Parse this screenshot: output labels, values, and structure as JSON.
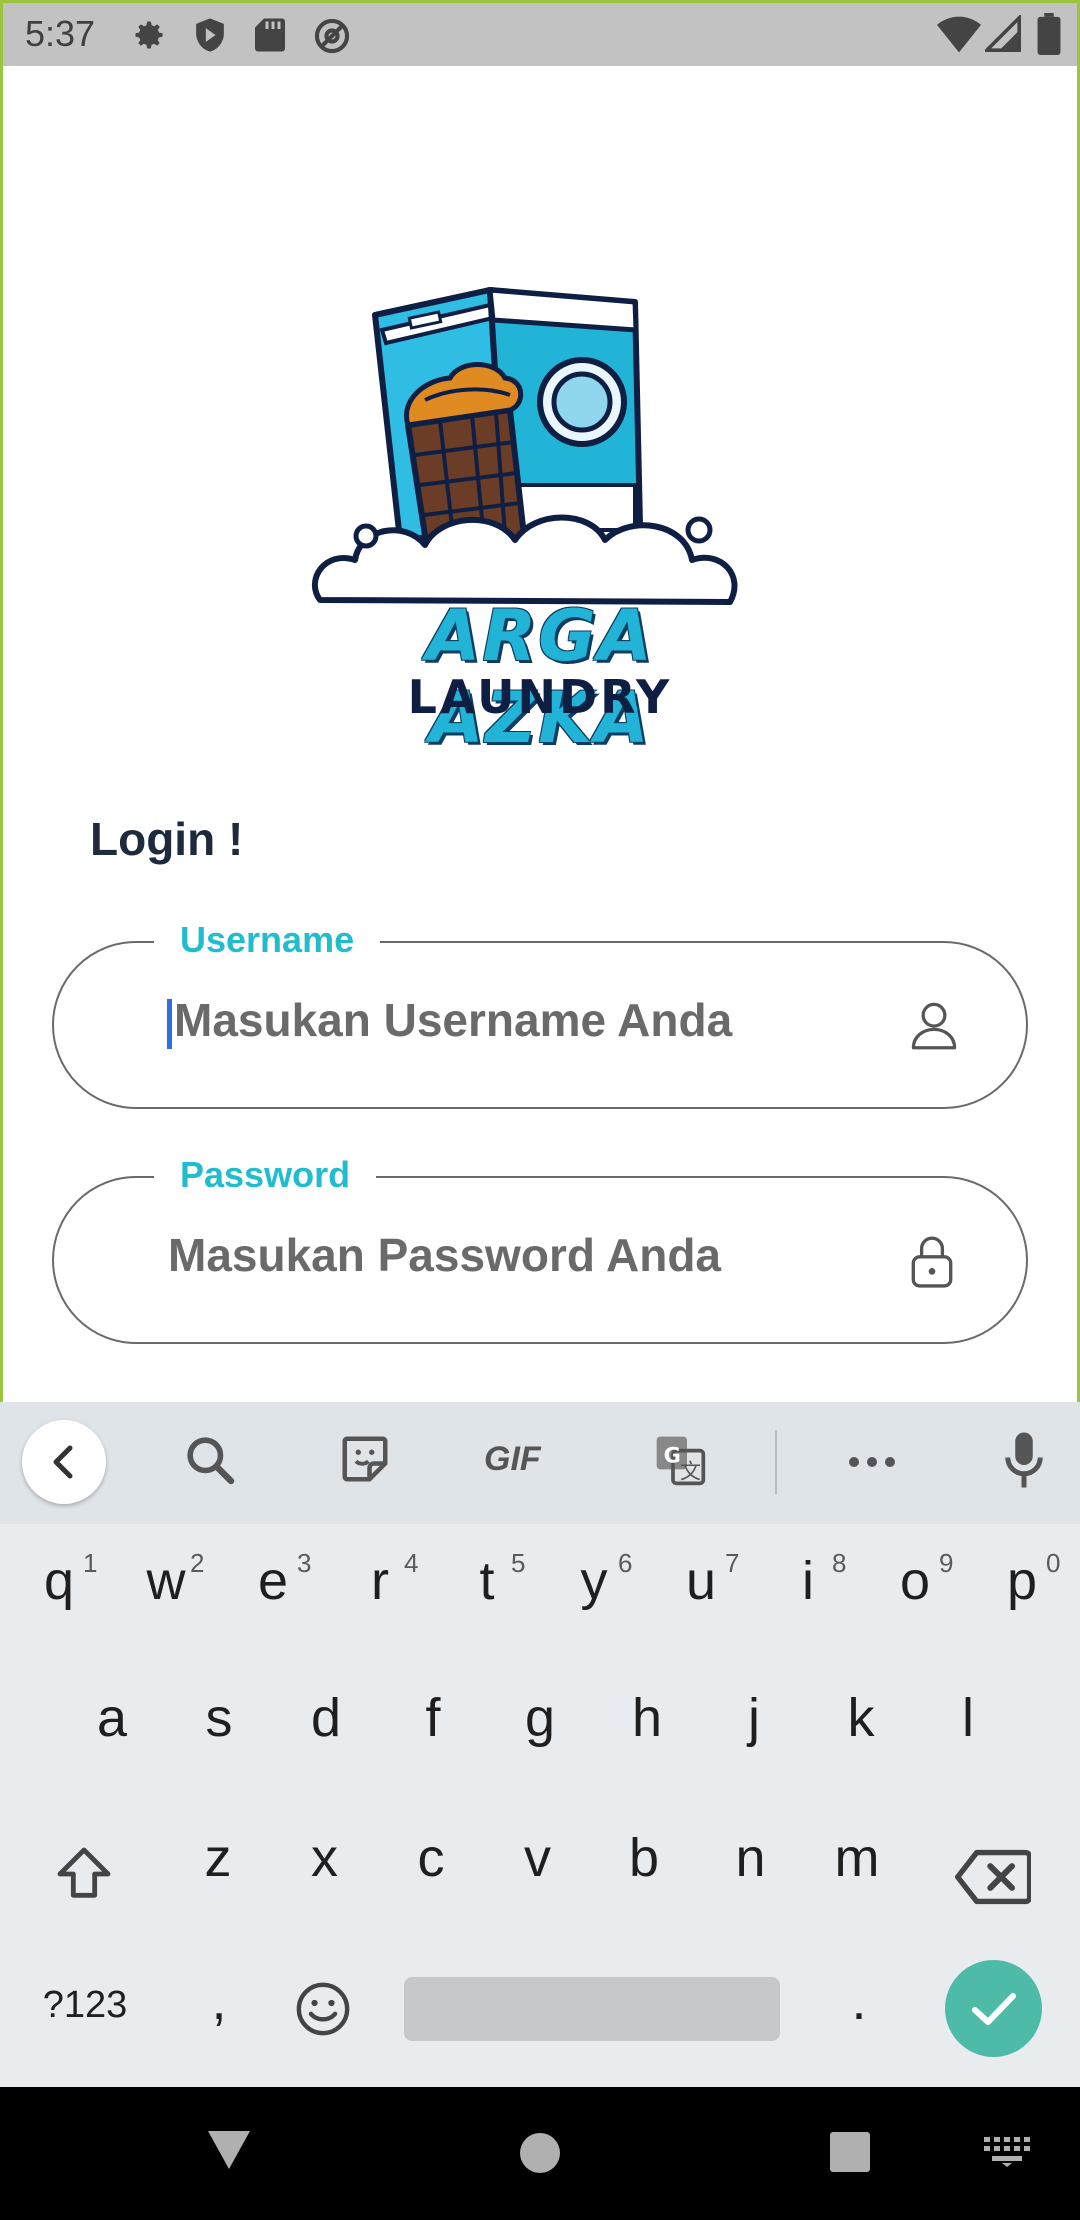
{
  "status_bar": {
    "time": "5:37",
    "left_icons": [
      "gear-icon",
      "play-protect-icon",
      "sd-card-icon",
      "at-sign-icon"
    ],
    "right_icons": [
      "wifi-icon",
      "signal-icon",
      "battery-icon"
    ]
  },
  "logo": {
    "line1": "ARGA AZKA",
    "line2": "LAUNDRY",
    "colors": {
      "primary": "#21b4d6",
      "dark": "#0f1f44"
    }
  },
  "login": {
    "title": "Login !",
    "username": {
      "label": "Username",
      "placeholder": "Masukan Username Anda",
      "icon": "user-icon"
    },
    "password": {
      "label": "Password",
      "placeholder": "Masukan Password Anda",
      "icon": "lock-icon"
    }
  },
  "keyboard": {
    "toolbar": [
      "back",
      "search-icon",
      "sticker-icon",
      "GIF",
      "translate-icon",
      "more-icon",
      "mic-icon"
    ],
    "gif_label": "GIF",
    "row1": [
      "q",
      "w",
      "e",
      "r",
      "t",
      "y",
      "u",
      "i",
      "o",
      "p"
    ],
    "row1_hints": [
      "1",
      "2",
      "3",
      "4",
      "5",
      "6",
      "7",
      "8",
      "9",
      "0"
    ],
    "row2": [
      "a",
      "s",
      "d",
      "f",
      "g",
      "h",
      "j",
      "k",
      "l"
    ],
    "row3": [
      "z",
      "x",
      "c",
      "v",
      "b",
      "n",
      "m"
    ],
    "symbols_label": "?123",
    "comma": ",",
    "period": "."
  },
  "nav_bar": [
    "back-icon",
    "home-icon",
    "recents-icon",
    "keyboard-switch-icon"
  ]
}
